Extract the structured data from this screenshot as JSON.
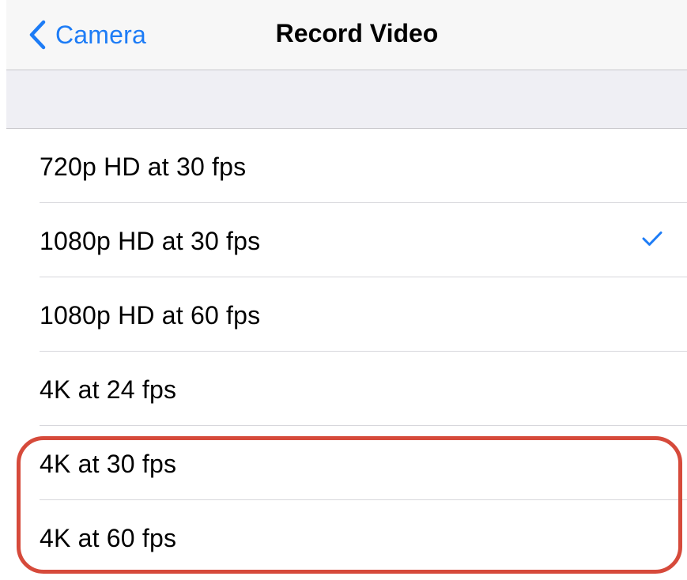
{
  "navbar": {
    "back_label": "Camera",
    "back_icon": "chevron-left-icon",
    "title": "Record Video"
  },
  "options": [
    {
      "label": "720p HD at 30 fps",
      "selected": false
    },
    {
      "label": "1080p HD at 30 fps",
      "selected": true
    },
    {
      "label": "1080p HD at 60 fps",
      "selected": false
    },
    {
      "label": "4K at 24 fps",
      "selected": false
    },
    {
      "label": "4K at 30 fps",
      "selected": false
    },
    {
      "label": "4K at 60 fps",
      "selected": false
    }
  ],
  "selected_icon": "checkmark-icon",
  "colors": {
    "accent": "#1d7cf6",
    "highlight": "#d64a3b",
    "navbar_bg": "#f7f7f7",
    "section_bg": "#efeff4"
  }
}
